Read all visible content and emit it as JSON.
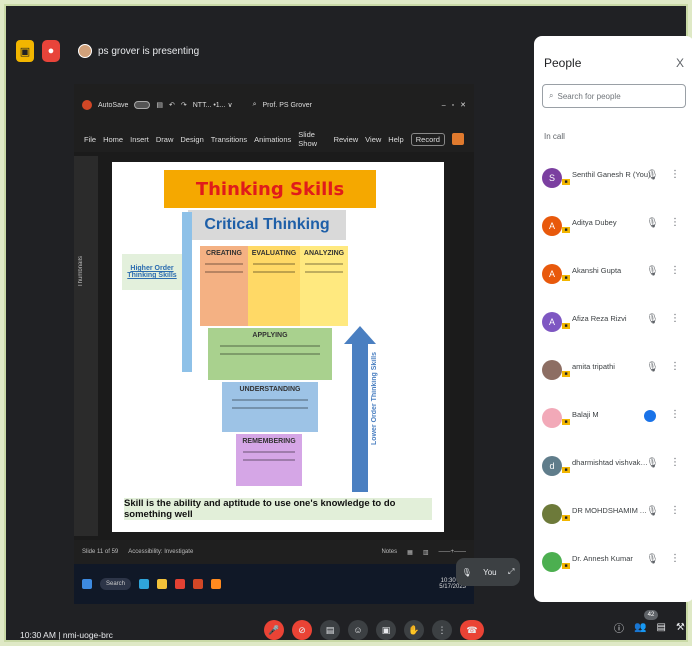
{
  "top_bar": {
    "presenting_text": "ps grover is presenting"
  },
  "ppt": {
    "autosave": "AutoSave",
    "file_name": "NTT... •1... ∨",
    "user": "Prof. PS Grover",
    "menu": [
      "File",
      "Home",
      "Insert",
      "Draw",
      "Design",
      "Transitions",
      "Animations",
      "Slide Show",
      "Review",
      "View",
      "Help"
    ],
    "record_label": "Record",
    "thumbnails_label": "Thumbnails",
    "status_slide": "Slide 11 of 59",
    "status_accessibility": "Accessibility: Investigate",
    "status_notes": "Notes"
  },
  "slide": {
    "title": "Thinking Skills",
    "subtitle": "Critical Thinking",
    "hots_label": "Higher Order Thinking Skills",
    "creating": "CREATING",
    "evaluating": "EVALUATING",
    "analyzing": "ANALYZING",
    "applying": "APPLYING",
    "understanding": "UNDERSTANDING",
    "remembering": "REMEMBERING",
    "lots_label": "Lower Order Thinking Skills",
    "skill_line": "Skill is the ability and aptitude to use one's knowledge to do something well"
  },
  "taskbar": {
    "search": "Search",
    "time": "10:30 AM",
    "date": "5/17/2023"
  },
  "self_tile": {
    "label": "You"
  },
  "people_panel": {
    "title": "People",
    "close": "X",
    "search_placeholder": "Search for people",
    "section": "In call",
    "people": [
      {
        "initial": "S",
        "name": "Senthil Ganesh R (You)",
        "color": "#7b3fa0"
      },
      {
        "initial": "A",
        "name": "Aditya Dubey",
        "color": "#e8590c"
      },
      {
        "initial": "A",
        "name": "Akanshi Gupta",
        "color": "#e8590c"
      },
      {
        "initial": "A",
        "name": "Afiza Reza Rizvi",
        "color": "#7e57c2"
      },
      {
        "initial": "",
        "name": "amita tripathi",
        "color": "#8d6e63"
      },
      {
        "initial": "",
        "name": "Balaji M",
        "color": "#f2a9b8"
      },
      {
        "initial": "d",
        "name": "dharmishtad vishvakarma",
        "color": "#607d8b"
      },
      {
        "initial": "",
        "name": "DR MOHDSHAMIM ANSA...",
        "color": "#6d7a3a"
      },
      {
        "initial": "",
        "name": "Dr. Annesh Kumar",
        "color": "#4caf50"
      }
    ]
  },
  "bottom": {
    "time_meeting": "10:30 AM  |  nmi-uoge-brc",
    "participant_count": "42"
  }
}
